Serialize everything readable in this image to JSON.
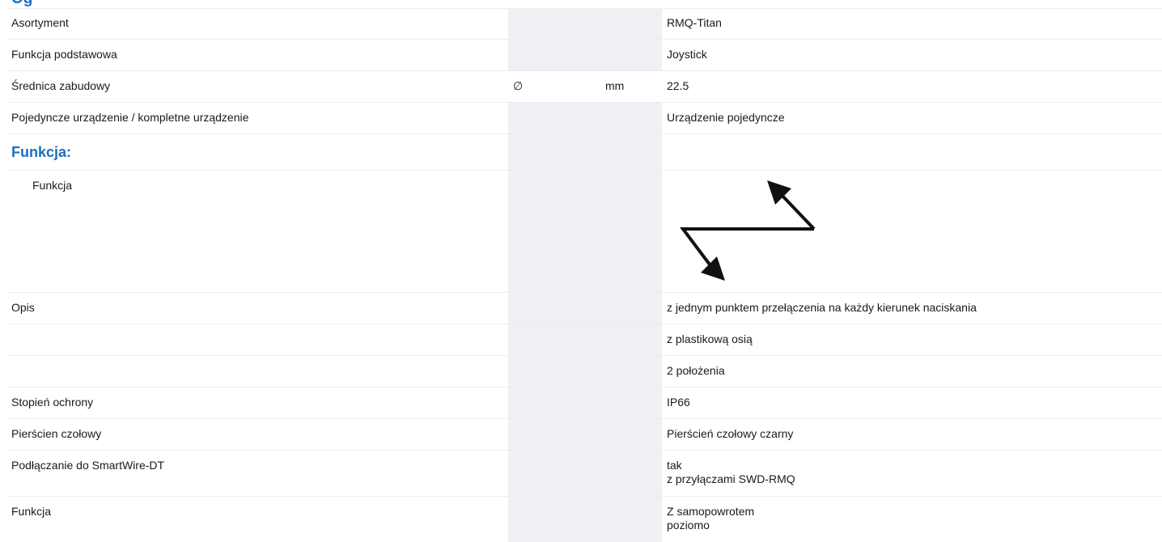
{
  "section_heading_cut": "Og",
  "rows": [
    {
      "label": "Asortyment",
      "symbol": "",
      "unit": "",
      "value": "RMQ-Titan"
    },
    {
      "label": "Funkcja podstawowa",
      "symbol": "",
      "unit": "",
      "value": "Joystick"
    },
    {
      "label": "Średnica zabudowy",
      "symbol": "∅",
      "unit": "mm",
      "value": "22.5"
    },
    {
      "label": "Pojedyncze urządzenie / kompletne urządzenie",
      "symbol": "",
      "unit": "",
      "value": "Urządzenie pojedyncze"
    }
  ],
  "function_section": {
    "title": "Funkcja:",
    "sub_label": "Funkcja",
    "diagram_icon": "joystick-diagonal-arrows-icon"
  },
  "rows2": [
    {
      "label": "Opis",
      "value": "z jednym punktem przełączenia na każdy kierunek naciskania"
    },
    {
      "label": "",
      "value": "z plastikową osią"
    },
    {
      "label": "",
      "value": "2 położenia"
    },
    {
      "label": "Stopień ochrony",
      "value": "IP66"
    },
    {
      "label": "Pierścien czołowy",
      "value": "Pierścień czołowy czarny"
    }
  ],
  "smartwire": {
    "label": "Podłączanie do SmartWire-DT",
    "value_line1": "tak",
    "value_line2": "z przyłączami SWD-RMQ"
  },
  "funkcja_last": {
    "label": "Funkcja",
    "value_line1": "Z samopowrotem",
    "value_line2": "poziomo"
  },
  "colors": {
    "heading": "#1b6fbf",
    "column_shade": "#eef0f4",
    "row_border": "#ececf2"
  }
}
